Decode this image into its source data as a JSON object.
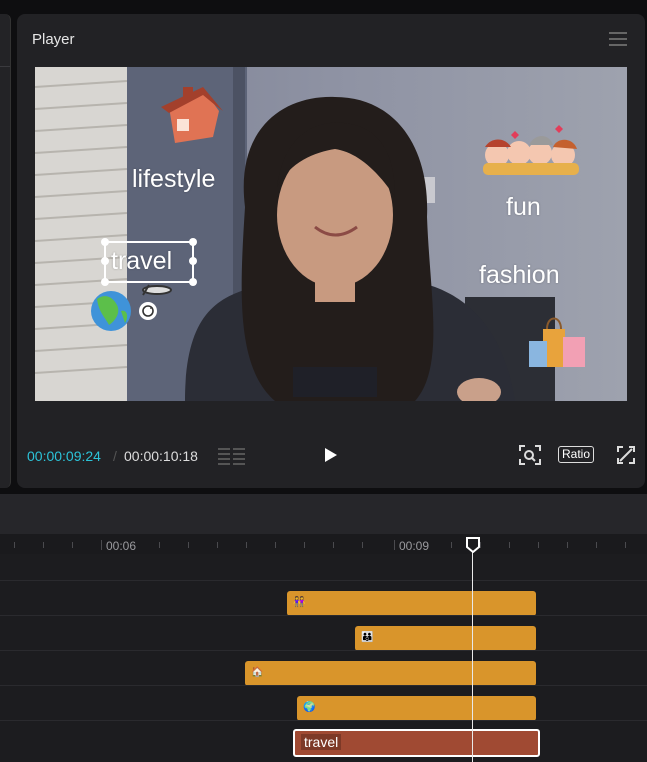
{
  "player": {
    "title": "Player",
    "overlays": {
      "lifestyle": "lifestyle",
      "travel": "travel",
      "fun": "fun",
      "fashion": "fashion"
    },
    "current_time": "00:00:09:24",
    "separator": "/",
    "total_time": "00:00:10:18",
    "ratio_label": "Ratio"
  },
  "timeline": {
    "ruler_labels": [
      "00:06",
      "00:09"
    ],
    "text_clip_label": "travel"
  },
  "colors": {
    "accent_time": "#2cc3d8",
    "sticker_clip": "#d9952b",
    "text_clip": "#a04a33"
  }
}
